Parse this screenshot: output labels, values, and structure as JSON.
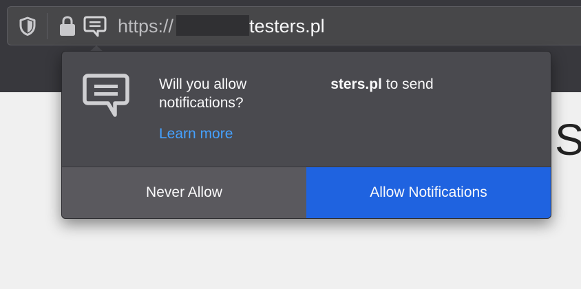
{
  "browser": {
    "urlbar": {
      "scheme": "https://",
      "domain": "testers.pl",
      "icons": [
        "tracking-protection-shield-icon",
        "lock-icon",
        "notification-permission-icon"
      ]
    }
  },
  "page": {
    "visible_text": "S"
  },
  "permission_panel": {
    "message_line1_prefix": "Will you allow",
    "message_host": "sters.pl",
    "message_line1_suffix": " to send",
    "message_line2": "notifications?",
    "learn_more": "Learn more",
    "secondary_button": "Never Allow",
    "primary_button": "Allow Notifications",
    "icon": "notification-bubble-icon"
  },
  "colors": {
    "toolbar": "#38383d",
    "panel": "#4a4a4f",
    "primary_button": "#1f63e0",
    "secondary_button": "#5a595e",
    "link": "#45a1ff"
  }
}
